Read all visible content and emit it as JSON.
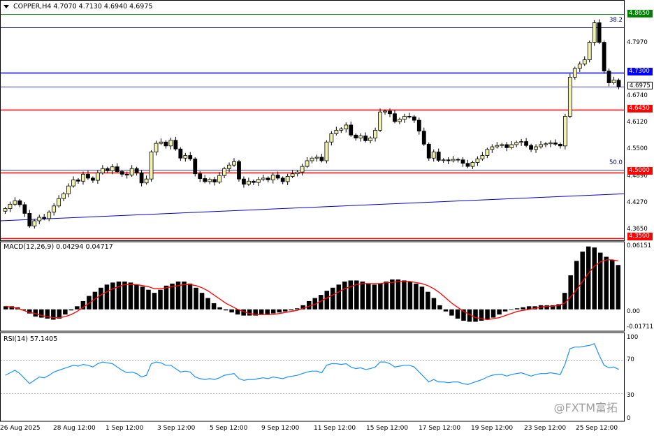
{
  "header": {
    "symbol_line": "COPPER,H4  4.7070 4.7130 4.6940 4.6975"
  },
  "price_axis": {
    "ticks": [
      "4.8650",
      "4.7970",
      "4.7300",
      "4.6975",
      "4.6740",
      "4.6450",
      "4.6120",
      "4.5500",
      "4.5000",
      "4.4890",
      "4.4270",
      "4.3650",
      "4.3500"
    ],
    "highlighted": [
      {
        "value": "4.8650",
        "bg": "#008000",
        "fg": "#ffffff"
      },
      {
        "value": "4.7300",
        "bg": "#0000ff",
        "fg": "#ffffff"
      },
      {
        "value": "4.6975",
        "bg": "#ffffff",
        "fg": "#000000"
      },
      {
        "value": "4.6450",
        "bg": "#ff0000",
        "fg": "#ffffff"
      },
      {
        "value": "4.5000",
        "bg": "#ff0000",
        "fg": "#ffffff"
      },
      {
        "value": "4.3500",
        "bg": "#ff0000",
        "fg": "#ffffff"
      }
    ]
  },
  "levels": {
    "fib_382_label": "38.2",
    "fib_500_label": "50.0"
  },
  "macd": {
    "label": "MACD(12,26,9) 0.04294 0.04717",
    "ticks": [
      "0.06151",
      "0.00",
      "-0.01711"
    ]
  },
  "rsi": {
    "label": "RSI(14) 57.1405",
    "ticks": [
      "100",
      "70",
      "30",
      "0"
    ]
  },
  "time_axis": [
    "26 Aug 2025",
    "28 Aug 12:00",
    "1 Sep 12:00",
    "3 Sep 12:00",
    "5 Sep 12:00",
    "9 Sep 12:00",
    "11 Sep 12:00",
    "15 Sep 12:00",
    "17 Sep 12:00",
    "19 Sep 12:00",
    "23 Sep 12:00",
    "25 Sep 12:00"
  ],
  "watermark": "@FXTM富拓",
  "colors": {
    "bull": "#f2f2b0",
    "bear": "#000000",
    "signal": "#ff0000",
    "support": "#ff0000",
    "resistance": "#0000ff",
    "high_level": "#008000"
  },
  "chart_data": {
    "type": "candlestick",
    "instrument": "COPPER",
    "timeframe": "H4",
    "ohlc_last": {
      "open": 4.707,
      "high": 4.713,
      "low": 4.694,
      "close": 4.6975
    },
    "x_labels": [
      "26 Aug 2025",
      "28 Aug 12:00",
      "1 Sep 12:00",
      "3 Sep 12:00",
      "5 Sep 12:00",
      "9 Sep 12:00",
      "11 Sep 12:00",
      "15 Sep 12:00",
      "17 Sep 12:00",
      "19 Sep 12:00",
      "23 Sep 12:00",
      "25 Sep 12:00"
    ],
    "ylim": [
      4.345,
      4.87
    ],
    "horizontal_levels": [
      4.865,
      4.73,
      4.6975,
      4.645,
      4.5,
      4.35
    ],
    "fib_levels": [
      {
        "label": "38.2",
        "value": 4.834
      },
      {
        "label": "50.0",
        "value": 4.507
      }
    ],
    "trendline": {
      "from": 4.39,
      "to": 4.452
    },
    "close": [
      4.418,
      4.428,
      4.436,
      4.427,
      4.407,
      4.378,
      4.39,
      4.398,
      4.395,
      4.41,
      4.424,
      4.441,
      4.452,
      4.47,
      4.484,
      4.481,
      4.497,
      4.488,
      4.483,
      4.5,
      4.51,
      4.505,
      4.514,
      4.503,
      4.497,
      4.495,
      4.51,
      4.5,
      4.477,
      4.486,
      4.548,
      4.568,
      4.571,
      4.562,
      4.575,
      4.555,
      4.534,
      4.54,
      4.532,
      4.498,
      4.487,
      4.48,
      4.485,
      4.479,
      4.494,
      4.51,
      4.518,
      4.526,
      4.486,
      4.474,
      4.481,
      4.478,
      4.485,
      4.488,
      4.484,
      4.495,
      4.488,
      4.48,
      4.492,
      4.498,
      4.502,
      4.515,
      4.528,
      4.534,
      4.536,
      4.528,
      4.571,
      4.59,
      4.598,
      4.601,
      4.61,
      4.587,
      4.58,
      4.585,
      4.574,
      4.58,
      4.598,
      4.64,
      4.642,
      4.636,
      4.618,
      4.623,
      4.63,
      4.629,
      4.621,
      4.596,
      4.566,
      4.534,
      4.548,
      4.529,
      4.53,
      4.528,
      4.531,
      4.53,
      4.522,
      4.515,
      4.524,
      4.532,
      4.54,
      4.554,
      4.56,
      4.563,
      4.565,
      4.558,
      4.565,
      4.57,
      4.572,
      4.563,
      4.554,
      4.56,
      4.565,
      4.567,
      4.569,
      4.566,
      4.562,
      4.63,
      4.72,
      4.74,
      4.75,
      4.76,
      4.8,
      4.845,
      4.8,
      4.734,
      4.707,
      4.713,
      4.698
    ],
    "macd_hist": [
      0.003,
      0.003,
      0.002,
      -0.001,
      -0.004,
      -0.007,
      -0.008,
      -0.009,
      -0.01,
      -0.009,
      -0.005,
      -0.001,
      0.003,
      0.008,
      0.013,
      0.017,
      0.021,
      0.024,
      0.026,
      0.027,
      0.027,
      0.026,
      0.024,
      0.022,
      0.019,
      0.016,
      0.019,
      0.023,
      0.025,
      0.027,
      0.027,
      0.025,
      0.021,
      0.016,
      0.011,
      0.006,
      0.002,
      -0.001,
      -0.003,
      -0.005,
      -0.006,
      -0.006,
      -0.006,
      -0.005,
      -0.005,
      -0.004,
      -0.003,
      -0.002,
      -0.001,
      0.001,
      0.004,
      0.008,
      0.011,
      0.014,
      0.018,
      0.021,
      0.024,
      0.027,
      0.028,
      0.028,
      0.027,
      0.025,
      0.024,
      0.025,
      0.027,
      0.029,
      0.029,
      0.028,
      0.027,
      0.025,
      0.022,
      0.017,
      0.011,
      0.004,
      -0.002,
      -0.006,
      -0.009,
      -0.011,
      -0.012,
      -0.012,
      -0.011,
      -0.01,
      -0.008,
      -0.005,
      -0.002,
      0.0,
      0.001,
      0.002,
      0.003,
      0.003,
      0.004,
      0.004,
      0.004,
      0.005,
      0.016,
      0.033,
      0.047,
      0.056,
      0.061,
      0.06,
      0.055,
      0.051,
      0.048,
      0.043
    ],
    "macd_signal": [
      0.003,
      0.002,
      0.001,
      -0.001,
      -0.003,
      -0.004,
      -0.006,
      -0.007,
      -0.008,
      -0.008,
      -0.007,
      -0.005,
      -0.002,
      0.002,
      0.006,
      0.01,
      0.014,
      0.017,
      0.02,
      0.022,
      0.024,
      0.024,
      0.024,
      0.023,
      0.022,
      0.02,
      0.02,
      0.021,
      0.022,
      0.023,
      0.024,
      0.024,
      0.023,
      0.021,
      0.018,
      0.014,
      0.01,
      0.006,
      0.003,
      0.0,
      -0.002,
      -0.004,
      -0.005,
      -0.005,
      -0.005,
      -0.005,
      -0.004,
      -0.003,
      -0.002,
      -0.001,
      0.001,
      0.003,
      0.005,
      0.008,
      0.011,
      0.014,
      0.017,
      0.02,
      0.022,
      0.024,
      0.025,
      0.025,
      0.025,
      0.025,
      0.026,
      0.026,
      0.027,
      0.027,
      0.027,
      0.026,
      0.025,
      0.023,
      0.02,
      0.016,
      0.011,
      0.006,
      0.002,
      -0.002,
      -0.005,
      -0.008,
      -0.009,
      -0.01,
      -0.009,
      -0.008,
      -0.006,
      -0.004,
      -0.002,
      -0.001,
      0.0,
      0.001,
      0.002,
      0.003,
      0.003,
      0.004,
      0.006,
      0.012,
      0.019,
      0.027,
      0.035,
      0.042,
      0.046,
      0.048,
      0.048,
      0.047
    ],
    "rsi": [
      52,
      55,
      58,
      54,
      48,
      42,
      46,
      50,
      49,
      52,
      56,
      58,
      60,
      62,
      64,
      63,
      65,
      64,
      62,
      66,
      68,
      67,
      66,
      62,
      58,
      55,
      56,
      54,
      50,
      52,
      66,
      68,
      67,
      64,
      64,
      60,
      56,
      57,
      56,
      50,
      48,
      47,
      48,
      47,
      49,
      52,
      53,
      54,
      48,
      46,
      47,
      47,
      48,
      49,
      48,
      50,
      49,
      48,
      50,
      51,
      52,
      54,
      56,
      57,
      57,
      55,
      64,
      66,
      66,
      65,
      66,
      62,
      60,
      61,
      59,
      60,
      62,
      68,
      68,
      66,
      62,
      63,
      64,
      64,
      62,
      56,
      50,
      44,
      47,
      44,
      44,
      43,
      44,
      44,
      42,
      41,
      43,
      45,
      47,
      50,
      52,
      53,
      53,
      51,
      53,
      54,
      55,
      53,
      51,
      53,
      54,
      54,
      55,
      54,
      53,
      66,
      84,
      86,
      86,
      87,
      88,
      90,
      76,
      64,
      61,
      62,
      59
    ]
  }
}
